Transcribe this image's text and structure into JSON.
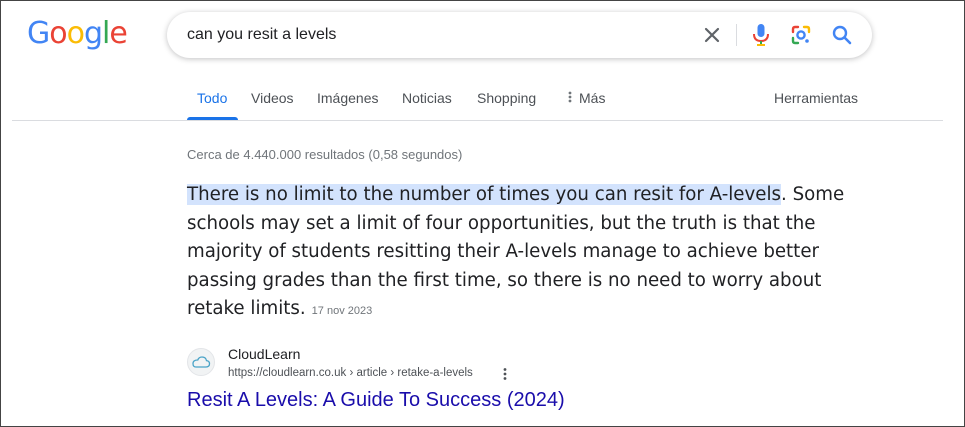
{
  "logo": {
    "text": "Google",
    "letters": [
      "G",
      "o",
      "o",
      "g",
      "l",
      "e"
    ],
    "colors": [
      "#4285f4",
      "#ea4335",
      "#fbbc05",
      "#4285f4",
      "#34a853",
      "#ea4335"
    ]
  },
  "search": {
    "query": "can you resit a levels",
    "icons": [
      "close-icon",
      "mic-icon",
      "lens-icon",
      "search-icon"
    ]
  },
  "tabs": [
    {
      "label": "Todo",
      "active": true
    },
    {
      "label": "Videos"
    },
    {
      "label": "Imágenes"
    },
    {
      "label": "Noticias"
    },
    {
      "label": "Shopping"
    },
    {
      "label": "Más",
      "icon": "more-vert-icon"
    }
  ],
  "tools_label": "Herramientas",
  "stats": "Cerca de 4.440.000 resultados (0,58 segundos)",
  "snippet": {
    "highlight": "There is no limit to the number of times you can resit for A-levels",
    "after_highlight": ".",
    "body": "Some schools may set a limit of four opportunities, but the truth is that the majority of students resitting their A-levels manage to achieve better passing grades than the first time, so there is no need to worry about retake limits.",
    "date": "17 nov 2023"
  },
  "result": {
    "site_name": "CloudLearn",
    "url": "https://cloudlearn.co.uk › article › retake-a-levels",
    "title": "Resit A Levels: A Guide To Success (2024)",
    "favicon": "cloud-icon"
  },
  "colors": {
    "accent": "#1a73e8",
    "link": "#1a0dab",
    "highlight": "#d3e3fd"
  }
}
